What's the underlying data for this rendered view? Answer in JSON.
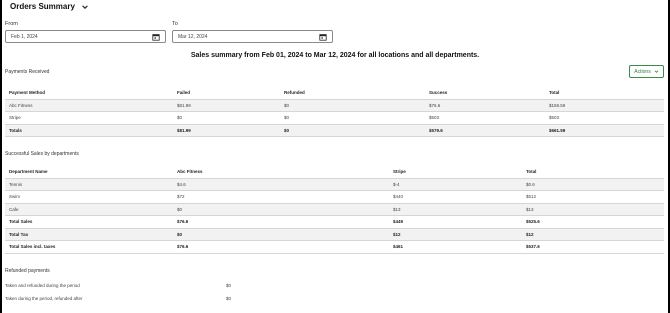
{
  "header": {
    "title": "Orders Summary"
  },
  "filters": {
    "from_label": "From",
    "from_value": "Feb 1, 2024",
    "to_label": "To",
    "to_value": "Mar 12, 2024"
  },
  "summary_heading": "Sales summary from Feb 01, 2024 to Mar 12, 2024 for all locations and all departments.",
  "payments": {
    "title": "Payments Received",
    "actions_label": "Actions",
    "columns": [
      "Payment Method",
      "Failed",
      "Refunded",
      "Success",
      "Total"
    ],
    "rows": [
      [
        "Abc Fitness",
        "$81.99",
        "$0",
        "$76.6",
        "$158.59"
      ],
      [
        "Stripe",
        "$0",
        "$0",
        "$503",
        "$503"
      ],
      [
        "Totals",
        "$81.99",
        "$0",
        "$579.6",
        "$661.59"
      ]
    ]
  },
  "departments": {
    "title": "Successful Sales by departments",
    "columns": [
      "Department Name",
      "Abc Fitness",
      "Stripe",
      "Total"
    ],
    "rows": [
      [
        "Tennis",
        "$4.6",
        "$-4",
        "$0.6"
      ],
      [
        "Swim",
        "$72",
        "$440",
        "$512"
      ],
      [
        "Cafe",
        "$0",
        "$13",
        "$13"
      ],
      [
        "Total Sales",
        "$76.6",
        "$449",
        "$525.6"
      ],
      [
        "Total Tax",
        "$0",
        "$12",
        "$12"
      ],
      [
        "Total Sales incl. taxes",
        "$76.6",
        "$461",
        "$537.6"
      ]
    ]
  },
  "refunds": {
    "title": "Refunded payments",
    "rows": [
      {
        "label": "Taken and refunded during the period",
        "value": "$0"
      },
      {
        "label": "Taken during the period, refunded after",
        "value": "$0"
      }
    ]
  }
}
